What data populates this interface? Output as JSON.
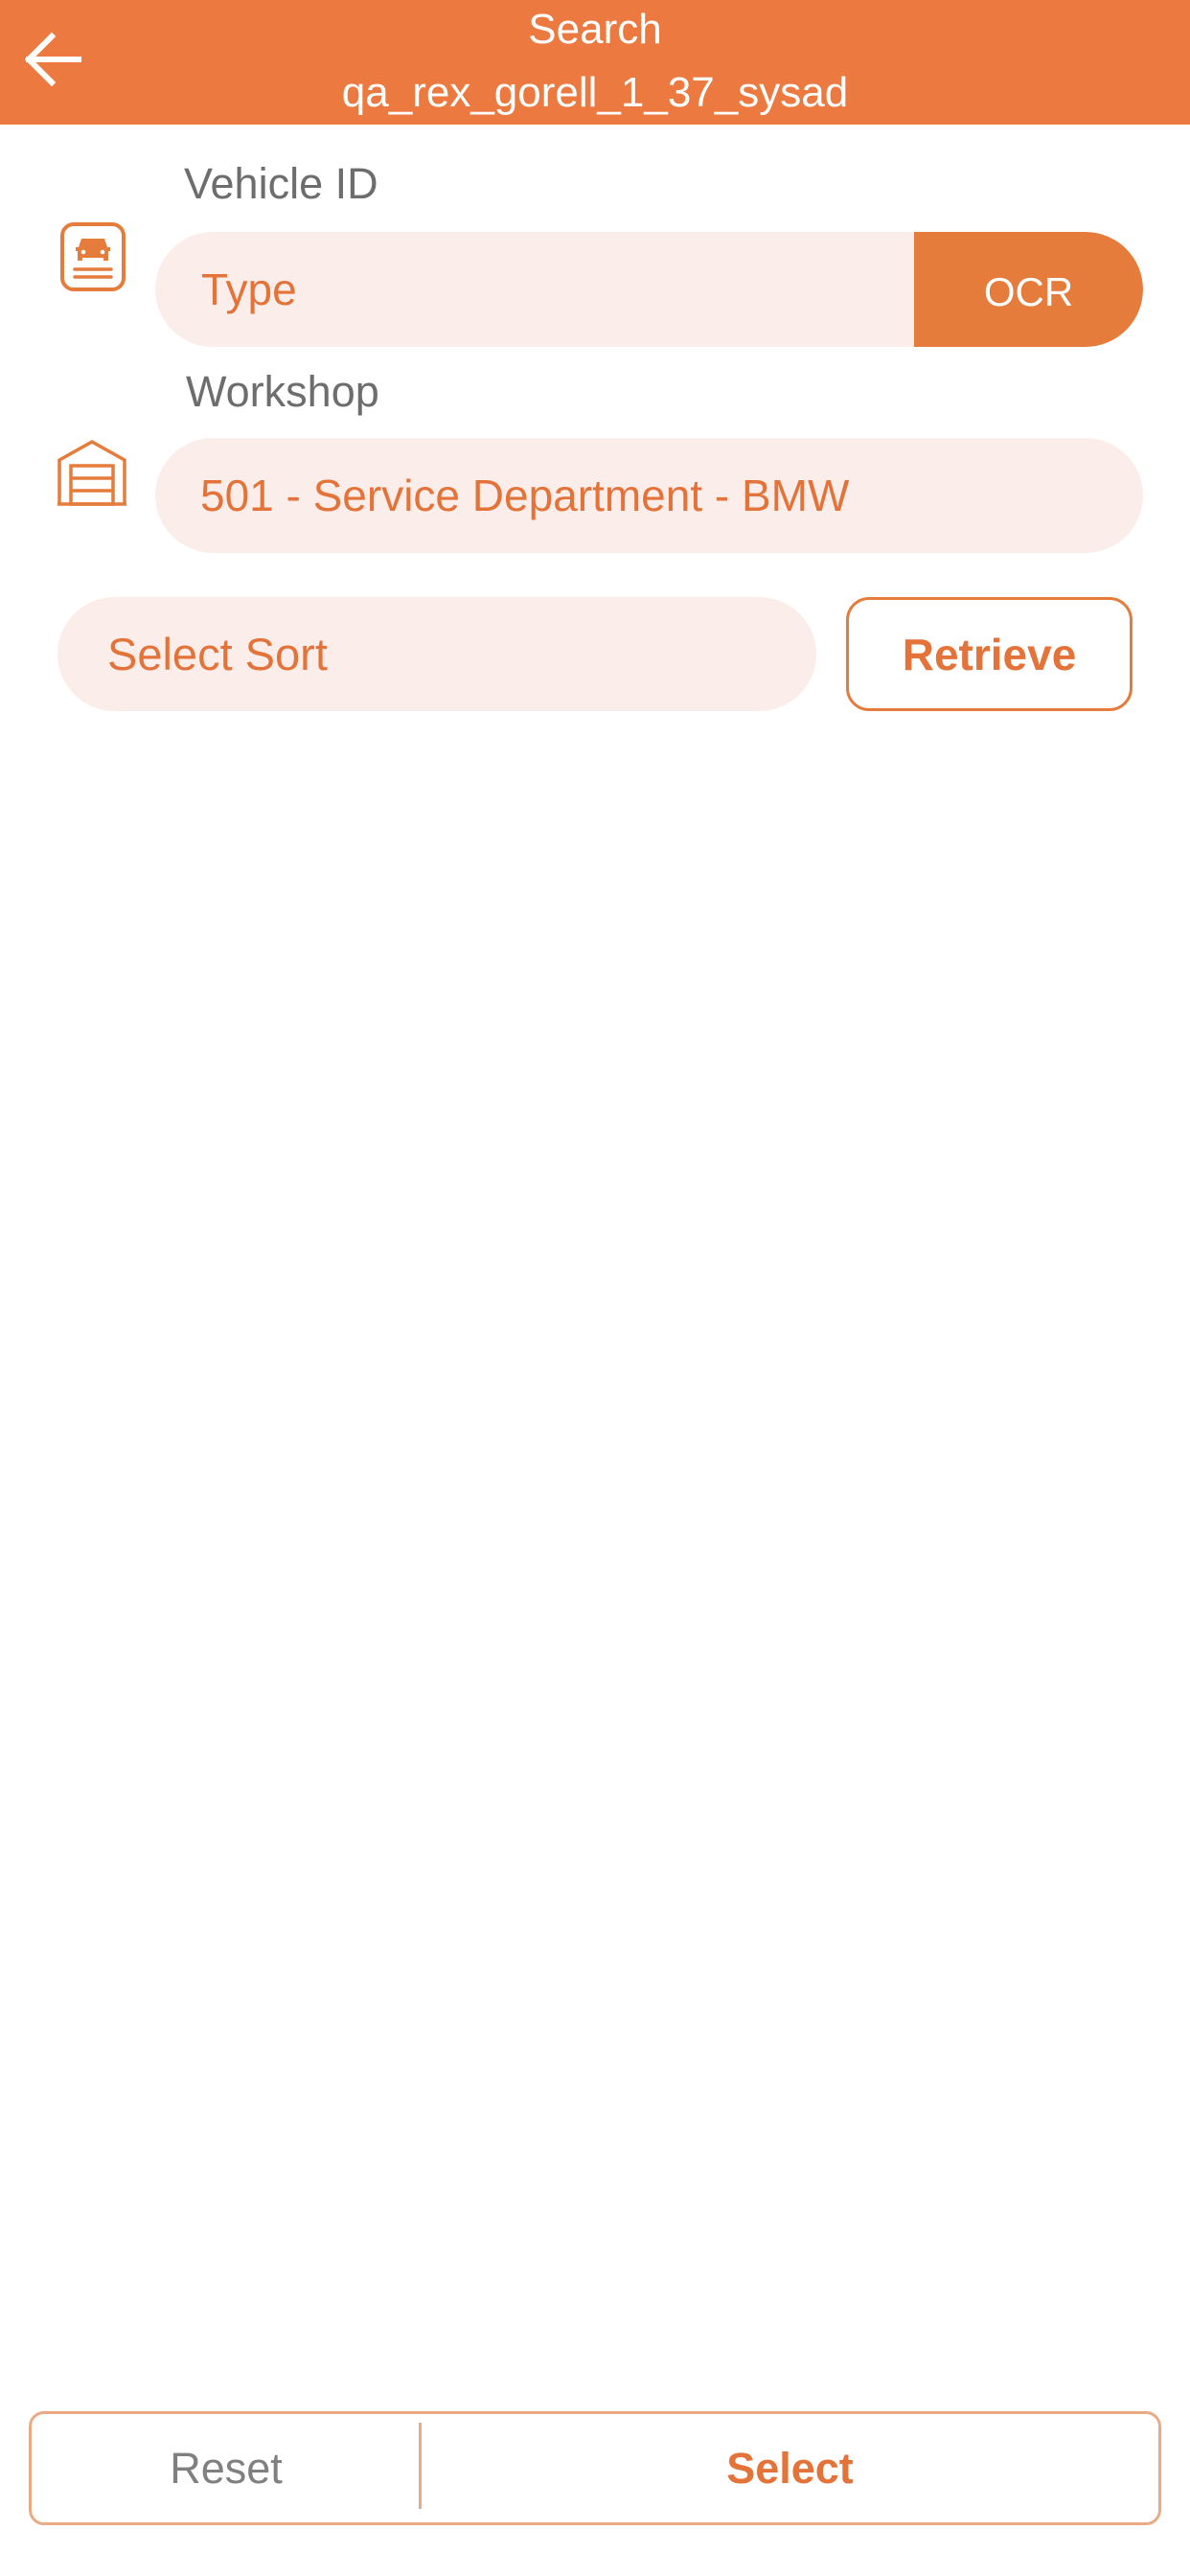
{
  "header": {
    "back_icon": "arrow-left-icon",
    "title": "Search",
    "subtitle": "qa_rex_gorell_1_37_sysad"
  },
  "vehicle": {
    "icon": "vehicle-document-icon",
    "label": "Vehicle ID",
    "value": "",
    "placeholder": "Type",
    "ocr_label": "OCR"
  },
  "workshop": {
    "icon": "garage-icon",
    "label": "Workshop",
    "value": "501 - Service Department - BMW"
  },
  "sort": {
    "placeholder": "Select Sort"
  },
  "actions": {
    "retrieve_label": "Retrieve",
    "reset_label": "Reset",
    "select_label": "Select"
  },
  "colors": {
    "accent": "#EC7A40",
    "input_background": "#FBEEEA",
    "label_text": "#6D6D6D",
    "border_light": "#EAAA86"
  }
}
